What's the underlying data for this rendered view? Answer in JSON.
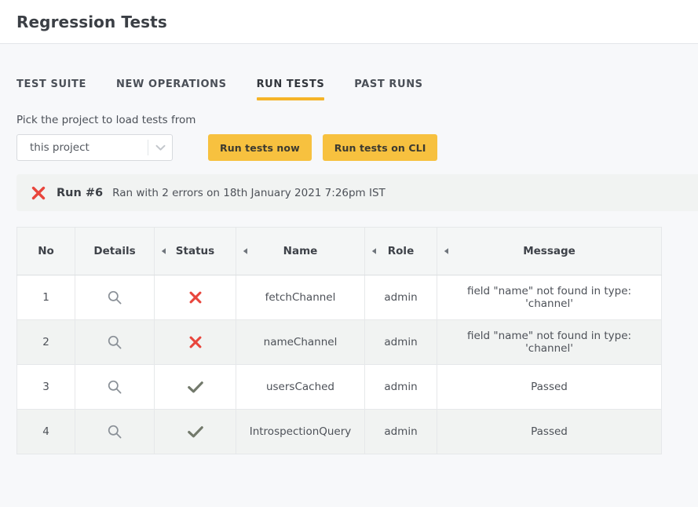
{
  "header": {
    "title": "Regression Tests"
  },
  "tabs": [
    {
      "label": "TEST SUITE",
      "active": false,
      "name": "tab-test-suite"
    },
    {
      "label": "NEW OPERATIONS",
      "active": false,
      "name": "tab-new-operations"
    },
    {
      "label": "RUN TESTS",
      "active": true,
      "name": "tab-run-tests"
    },
    {
      "label": "PAST RUNS",
      "active": false,
      "name": "tab-past-runs"
    }
  ],
  "picker": {
    "label": "Pick the project to load tests from",
    "select_value": "this project",
    "select_icon": "chevron-down-icon",
    "run_now_label": "Run tests now",
    "run_cli_label": "Run tests on CLI"
  },
  "run_banner": {
    "status_icon": "x-mark-icon",
    "run_id": "Run #6",
    "description": "Ran with 2 errors on 18th January 2021 7:26pm IST"
  },
  "table": {
    "columns": [
      {
        "label": "No",
        "sortable": false
      },
      {
        "label": "Details",
        "sortable": false
      },
      {
        "label": "Status",
        "sortable": true
      },
      {
        "label": "Name",
        "sortable": true
      },
      {
        "label": "Role",
        "sortable": true
      },
      {
        "label": "Message",
        "sortable": true
      }
    ],
    "sort_icon": "sort-caret-left-icon",
    "details_icon": "search-icon",
    "rows": [
      {
        "no": "1",
        "details_icon": "search-icon",
        "status": "failed",
        "status_icon": "x-mark-icon",
        "name": "fetchChannel",
        "role": "admin",
        "message": "field \"name\" not found in type: 'channel'"
      },
      {
        "no": "2",
        "details_icon": "search-icon",
        "status": "failed",
        "status_icon": "x-mark-icon",
        "name": "nameChannel",
        "role": "admin",
        "message": "field \"name\" not found in type: 'channel'"
      },
      {
        "no": "3",
        "details_icon": "search-icon",
        "status": "passed",
        "status_icon": "check-mark-icon",
        "name": "usersCached",
        "role": "admin",
        "message": "Passed"
      },
      {
        "no": "4",
        "details_icon": "search-icon",
        "status": "passed",
        "status_icon": "check-mark-icon",
        "name": "IntrospectionQuery",
        "role": "admin",
        "message": "Passed"
      }
    ]
  },
  "colors": {
    "accent": "#f5b428",
    "button": "#f7c13f",
    "error": "#e8453c",
    "success": "#72796b",
    "page_bg": "#f7f8fa",
    "row_alt": "#f1f3f2"
  }
}
